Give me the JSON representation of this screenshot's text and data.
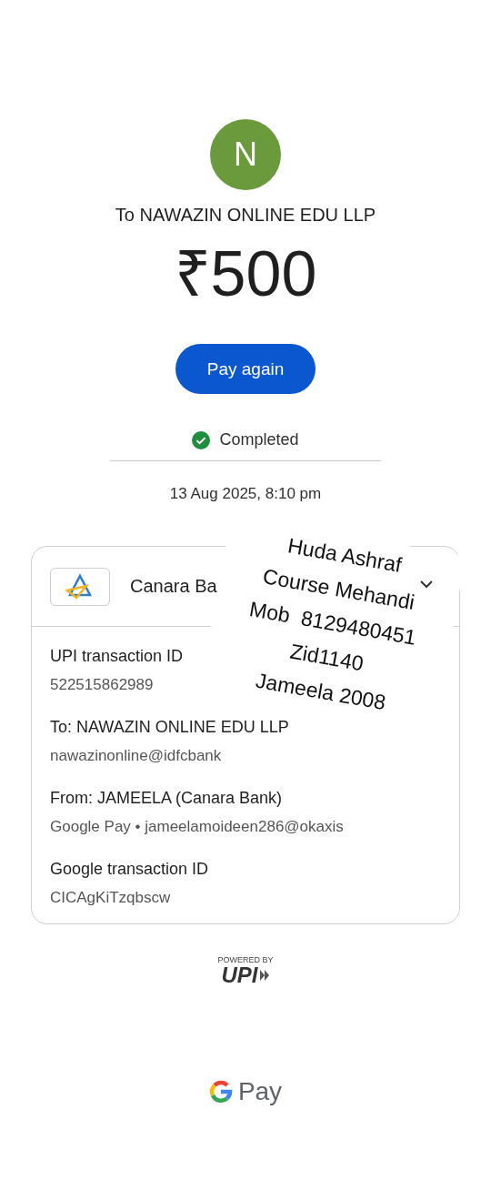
{
  "payee": {
    "avatar_letter": "N",
    "title": "To NAWAZIN ONLINE EDU LLP",
    "amount": "₹500"
  },
  "pay_again_button": "Pay again",
  "status": {
    "label": "Completed",
    "kind": "success"
  },
  "date": "13 Aug 2025, 8:10 pm",
  "card": {
    "bank_name": "Canara Ba",
    "details": [
      {
        "label": "UPI transaction ID",
        "value": "522515862989"
      },
      {
        "label": "To: NAWAZIN ONLINE EDU LLP",
        "value": "nawazinonline@idfcbank"
      },
      {
        "label": "From: JAMEELA (Canara Bank)",
        "value": "Google Pay • jameelamoideen286@okaxis"
      },
      {
        "label": "Google transaction ID",
        "value": "CICAgKiTzqbscw"
      }
    ]
  },
  "handwritten_note": [
    "Huda Ashraf",
    "Course Mehandi",
    "Mob  8129480451",
    "Zid1140",
    "Jameela 2008"
  ],
  "upi_badge": {
    "caption": "POWERED BY",
    "logo": "UPI"
  },
  "footer_brand": "Pay"
}
